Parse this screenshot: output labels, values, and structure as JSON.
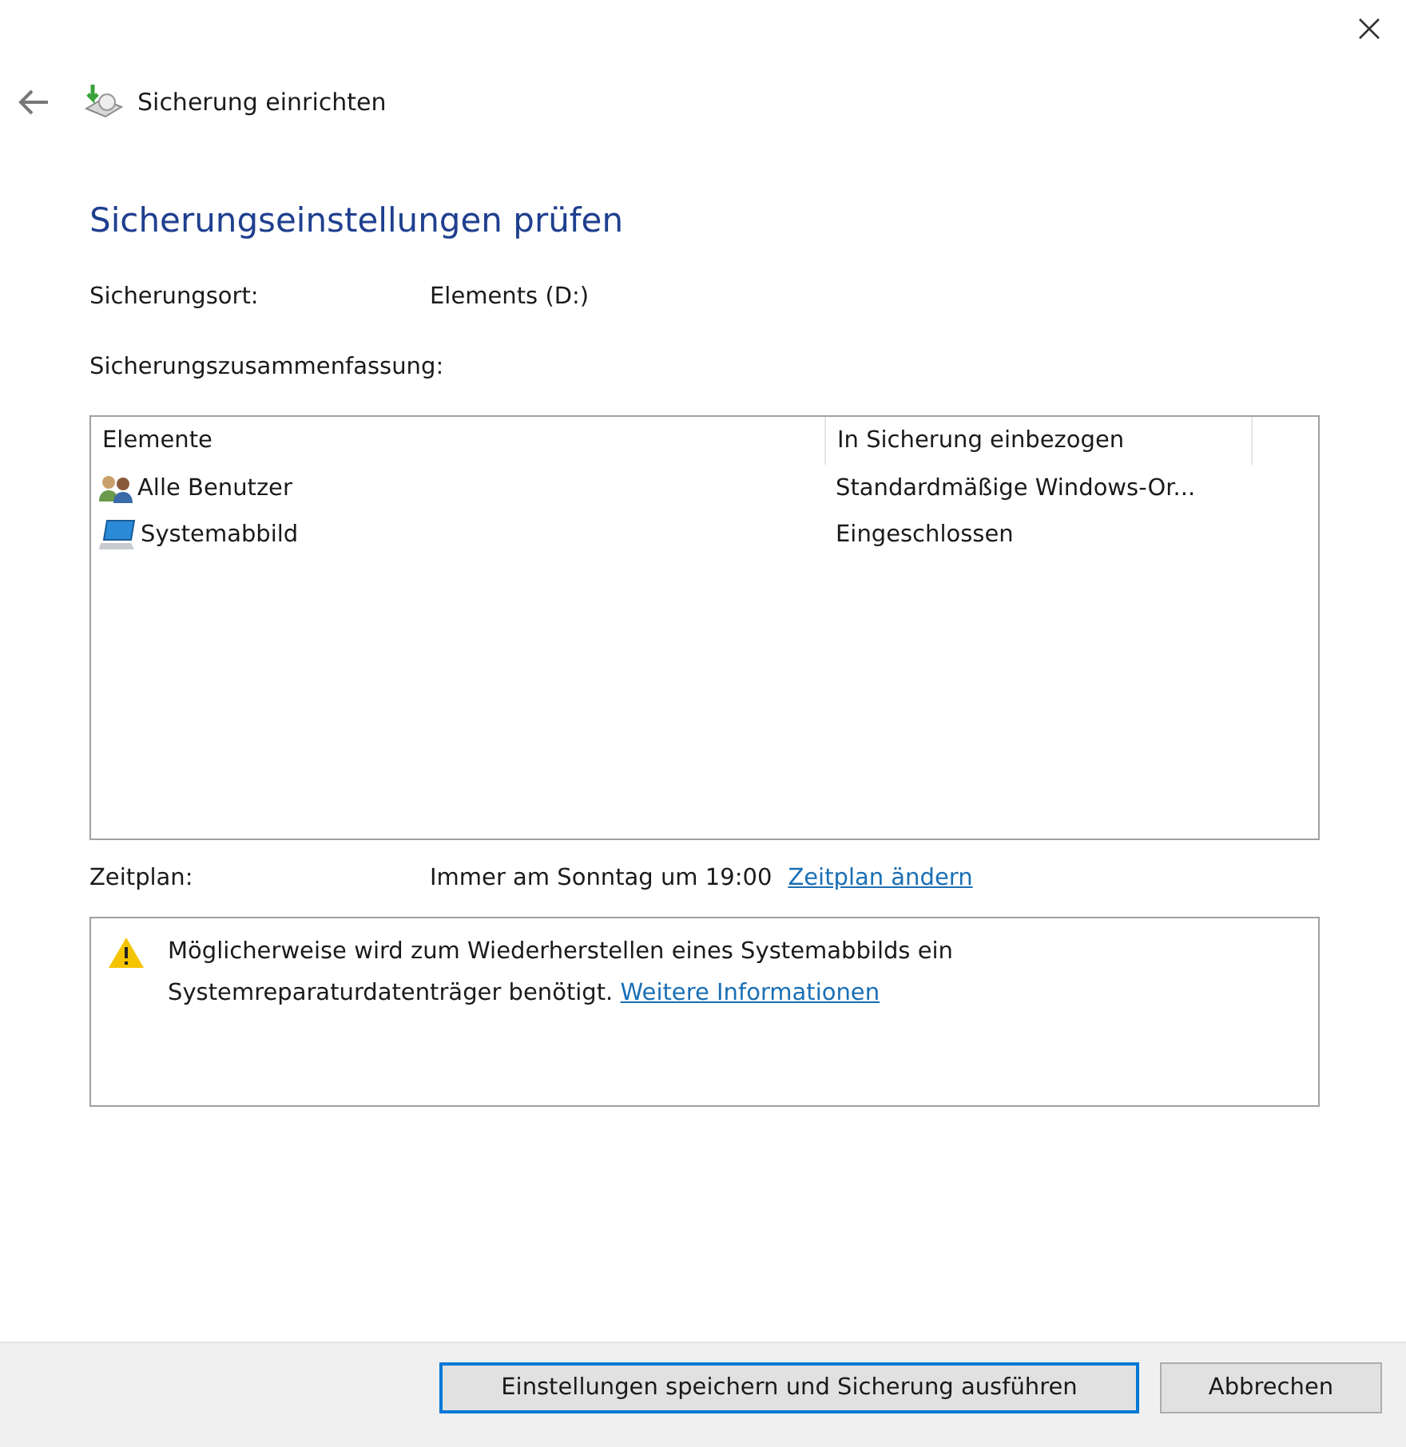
{
  "header": {
    "title": "Sicherung einrichten"
  },
  "heading": "Sicherungseinstellungen prüfen",
  "location": {
    "label": "Sicherungsort:",
    "value": "Elements (D:)"
  },
  "summary_label": "Sicherungszusammenfassung:",
  "table": {
    "columns": [
      "Elemente",
      "In Sicherung einbezogen"
    ],
    "rows": [
      {
        "kind": "users",
        "name": "Alle Benutzer",
        "value": "Standardmäßige Windows-Or..."
      },
      {
        "kind": "computer",
        "name": "Systemabbild",
        "value": "Eingeschlossen"
      }
    ]
  },
  "schedule": {
    "label": "Zeitplan:",
    "value": "Immer am Sonntag um 19:00",
    "link": "Zeitplan ändern"
  },
  "warning": {
    "text": "Möglicherweise wird zum Wiederherstellen eines Systemabbilds ein Systemreparaturdatenträger benötigt.",
    "link": "Weitere Informationen"
  },
  "buttons": [
    {
      "label": "Einstellungen speichern und Sicherung ausführen",
      "default": true
    },
    {
      "label": "Abbrechen",
      "default": false
    }
  ]
}
